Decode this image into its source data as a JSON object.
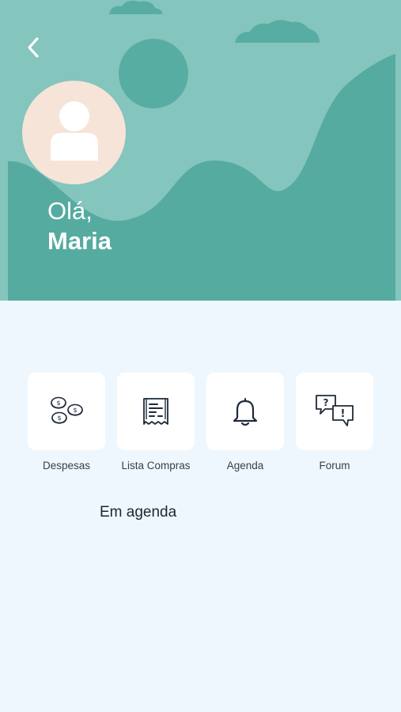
{
  "header": {
    "greeting": "Olá,",
    "user_name": "Maria"
  },
  "icons": {
    "back": "chevron-left-icon",
    "avatar": "user-silhouette-icon"
  },
  "menu": [
    {
      "label": "Despesas",
      "icon": "coins-icon"
    },
    {
      "label": "Lista Compras",
      "icon": "receipt-icon"
    },
    {
      "label": "Agenda",
      "icon": "bell-icon"
    },
    {
      "label": "Forum",
      "icon": "chat-bubbles-icon"
    }
  ],
  "section": {
    "title": "Em agenda"
  },
  "colors": {
    "hero_light": "#84C5BE",
    "hero_dark": "#55AB9F",
    "background": "#EEF7FE",
    "avatar_bg": "#F7E4D9",
    "icon_stroke": "#1E2A3A"
  }
}
